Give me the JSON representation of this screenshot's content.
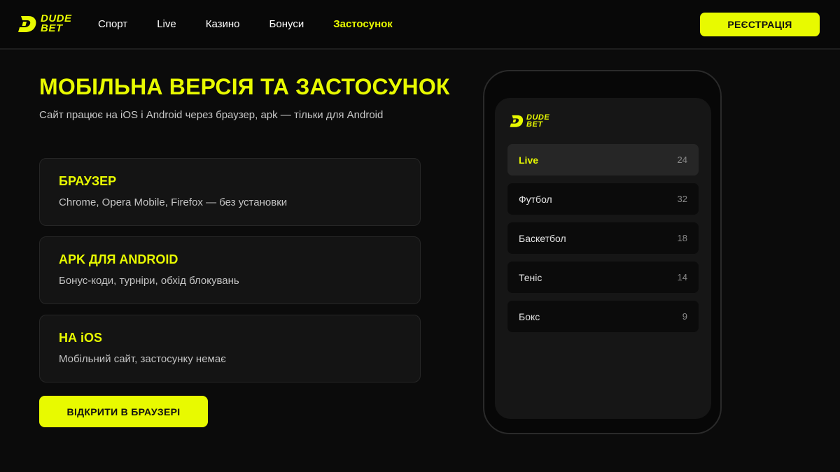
{
  "colors": {
    "accent": "#e8fa00",
    "background": "#0b0b0b",
    "card": "#141414"
  },
  "brand": {
    "line1": "DUDE",
    "line2": "BET",
    "icon": "dudebet-logo-icon"
  },
  "nav": {
    "items": [
      {
        "label": "Спорт"
      },
      {
        "label": "Live"
      },
      {
        "label": "Казино"
      },
      {
        "label": "Бонуси"
      },
      {
        "label": "Застосунок",
        "active": true
      }
    ]
  },
  "header": {
    "register_label": "РЕЄСТРАЦІЯ"
  },
  "main": {
    "title": "МОБІЛЬНА ВЕРСІЯ ТА ЗАСТОСУНОК",
    "subtitle": "Сайт працює на iOS і Android через браузер, apk — тільки для Android",
    "cards": [
      {
        "title": "БРАУЗЕР",
        "desc": "Chrome, Opera Mobile, Firefox — без установки"
      },
      {
        "title": "APK ДЛЯ ANDROID",
        "desc": "Бонус-коди, турніри, обхід блокувань"
      },
      {
        "title": "НА iOS",
        "desc": "Мобільний сайт, застосунку немає"
      }
    ],
    "open_button": "ВІДКРИТИ В БРАУЗЕРІ"
  },
  "phone": {
    "sports": [
      {
        "name": "Live",
        "count": "24",
        "active": true
      },
      {
        "name": "Футбол",
        "count": "32"
      },
      {
        "name": "Баскетбол",
        "count": "18"
      },
      {
        "name": "Теніс",
        "count": "14"
      },
      {
        "name": "Бокс",
        "count": "9"
      }
    ]
  }
}
